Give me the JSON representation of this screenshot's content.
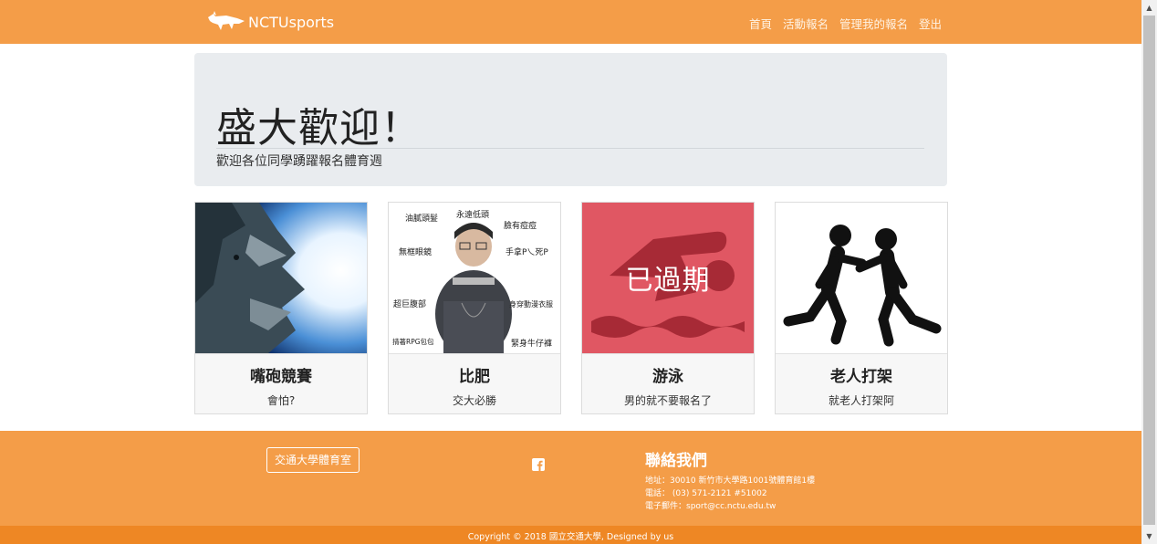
{
  "navbar": {
    "brand": "NCTUsports",
    "links": [
      "首頁",
      "活動報名",
      "管理我的報名",
      "登出"
    ]
  },
  "jumbotron": {
    "title": "盛大歡迎！",
    "lead": "歡迎各位同學踴躍報名體育週"
  },
  "cards": [
    {
      "title": "嘴砲競賽",
      "text": "會怕?"
    },
    {
      "title": "比肥",
      "text": "交大必勝",
      "image_labels": [
        "油膩頭髮",
        "永遠低頭",
        "臉有痘痘",
        "無框眼鏡",
        "手拿P乀死P",
        "超巨腹部",
        "身穿動漫衣服",
        "揹著RPG包包",
        "緊身牛仔褲"
      ]
    },
    {
      "title": "游泳",
      "text": "男的就不要報名了",
      "overlay": "已過期"
    },
    {
      "title": "老人打架",
      "text": "就老人打架阿"
    }
  ],
  "footer": {
    "button": "交通大學體育室",
    "contact_title": "聯絡我們",
    "address": "地址：30010 新竹市大學路1001號體育館1樓",
    "phone": "電話： (03) 571-2121 #51002",
    "email": "電子郵件：sport@cc.nctu.edu.tw",
    "copyright": "Copyright © 2018 國立交通大學, Designed by  us"
  },
  "colors": {
    "brand_orange": "#f49d48",
    "copyright_orange": "#ee8724",
    "expired_red": "#e05763"
  },
  "icons": [
    "fox-logo-icon",
    "facebook-icon",
    "swimmer-icon",
    "fighters-icon",
    "scroll-up-icon",
    "scroll-down-icon"
  ]
}
